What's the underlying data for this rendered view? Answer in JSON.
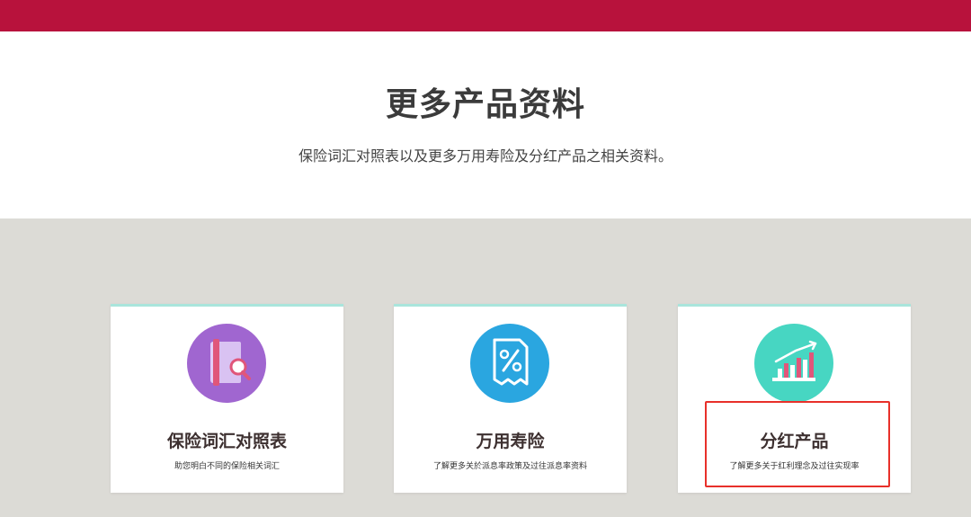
{
  "hero": {
    "title": "更多产品资料",
    "subtitle": "保险词汇对照表以及更多万用寿险及分红产品之相关资料。"
  },
  "cards": [
    {
      "title": "保险词汇对照表",
      "description": "助您明白不同的保险相关词汇",
      "icon": "glossary-book-search-icon",
      "icon_color": "#a066d0"
    },
    {
      "title": "万用寿险",
      "description": "了解更多关於派息率政策及过往派息率资料",
      "icon": "percent-document-icon",
      "icon_color": "#2aa6e0"
    },
    {
      "title": "分红产品",
      "description": "了解更多关于红利理念及过往实现率",
      "icon": "bar-chart-growth-icon",
      "icon_color": "#47d6c2"
    }
  ],
  "colors": {
    "header_bar": "#b8123c",
    "page_background": "#dcdbd6",
    "card_top_border": "#a9e5dc",
    "highlight_border": "#e8302a"
  }
}
